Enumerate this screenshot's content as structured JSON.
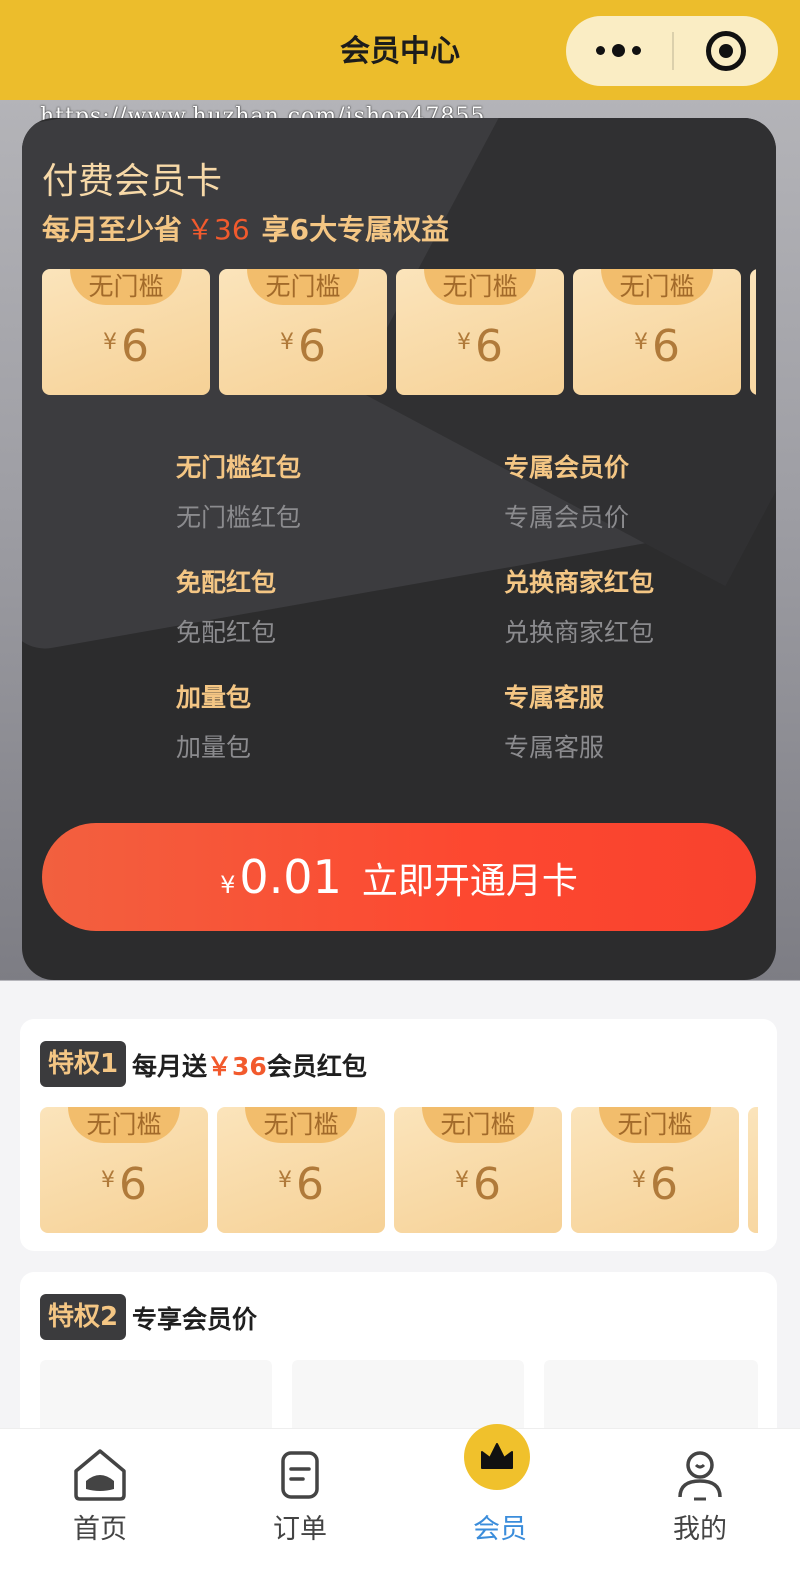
{
  "header": {
    "title": "会员中心"
  },
  "watermark": "https://www.huzhan.com/ishop47855",
  "card": {
    "title": "付费会员卡",
    "subtitle_prefix": "每月至少省",
    "subtitle_amount": "￥36",
    "subtitle_suffix": "享6大专属权益",
    "coupons": [
      {
        "tag": "无门槛",
        "currency": "¥",
        "value": "6"
      },
      {
        "tag": "无门槛",
        "currency": "¥",
        "value": "6"
      },
      {
        "tag": "无门槛",
        "currency": "¥",
        "value": "6"
      },
      {
        "tag": "无门槛",
        "currency": "¥",
        "value": "6"
      }
    ],
    "benefits": [
      {
        "title": "无门槛红包",
        "desc": "无门槛红包"
      },
      {
        "title": "专属会员价",
        "desc": "专属会员价"
      },
      {
        "title": "免配红包",
        "desc": "免配红包"
      },
      {
        "title": "兑换商家红包",
        "desc": "兑换商家红包"
      },
      {
        "title": "加量包",
        "desc": "加量包"
      },
      {
        "title": "专属客服",
        "desc": "专属客服"
      }
    ],
    "cta": {
      "currency": "¥",
      "price": "0.01",
      "label": "立即开通月卡"
    }
  },
  "privilege1": {
    "badge": "特权1",
    "title_prefix": "每月送",
    "title_amount": "￥36",
    "title_suffix": "会员红包",
    "coupons": [
      {
        "tag": "无门槛",
        "currency": "¥",
        "value": "6"
      },
      {
        "tag": "无门槛",
        "currency": "¥",
        "value": "6"
      },
      {
        "tag": "无门槛",
        "currency": "¥",
        "value": "6"
      },
      {
        "tag": "无门槛",
        "currency": "¥",
        "value": "6"
      }
    ]
  },
  "privilege2": {
    "badge": "特权2",
    "title": "专享会员价"
  },
  "tabbar": {
    "active_color": "#3b8ddb",
    "items": [
      {
        "label": "首页",
        "icon": "home-icon"
      },
      {
        "label": "订单",
        "icon": "order-icon"
      },
      {
        "label": "会员",
        "icon": "crown-icon"
      },
      {
        "label": "我的",
        "icon": "user-icon"
      }
    ]
  }
}
